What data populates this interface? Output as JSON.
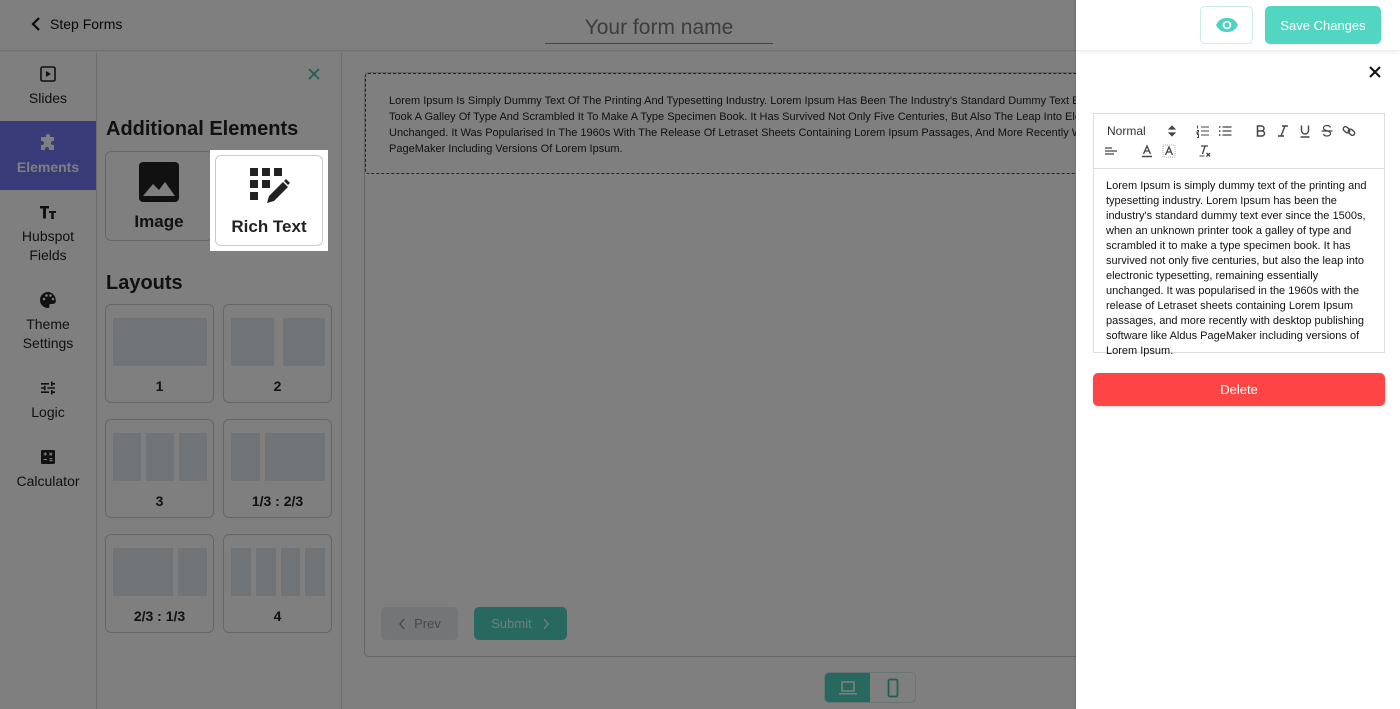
{
  "header": {
    "back_label": "Step Forms",
    "form_name_placeholder": "Your form name",
    "form_name_value": ""
  },
  "nav": {
    "items": [
      {
        "label": "Slides",
        "icon": "slides-icon"
      },
      {
        "label": "Elements",
        "icon": "puzzle-icon",
        "active": true
      },
      {
        "label": "Hubspot Fields",
        "icon": "text-size-icon"
      },
      {
        "label": "Theme Settings",
        "icon": "palette-icon"
      },
      {
        "label": "Logic",
        "icon": "sliders-icon"
      },
      {
        "label": "Calculator",
        "icon": "calculator-icon"
      }
    ]
  },
  "panel": {
    "additional_title": "Additional Elements",
    "elements": [
      {
        "label": "Image",
        "icon": "image-icon"
      },
      {
        "label": "Rich Text",
        "icon": "rich-text-icon",
        "highlighted": true
      }
    ],
    "layouts_title": "Layouts",
    "layouts": [
      {
        "label": "1"
      },
      {
        "label": "2"
      },
      {
        "label": "3"
      },
      {
        "label": "1/3 : 2/3"
      },
      {
        "label": "2/3 : 1/3"
      },
      {
        "label": "4"
      }
    ]
  },
  "canvas": {
    "rich_text_lines": [
      "Lorem Ipsum Is Simply Dummy Text Of The Printing And Typesetting Industry. Lorem Ipsum Has Been The Industry's Standard Dummy Text Ever Since The 1500s, When An Unknown Printer",
      "Took A Galley Of Type And Scrambled It To Make A Type Specimen Book. It Has Survived Not Only Five Centuries, But Also The Leap Into Electronic Typesetting, Remaining Essentially",
      "Unchanged. It Was Popularised In The 1960s With The Release Of Letraset Sheets Containing Lorem Ipsum Passages, And More Recently With Desktop Publishing Software Like Aldus",
      "PageMaker Including Versions Of Lorem Ipsum."
    ],
    "prev_label": "Prev",
    "submit_label": "Submit",
    "device_modes": [
      {
        "name": "desktop",
        "icon": "laptop-icon",
        "active": true
      },
      {
        "name": "mobile",
        "icon": "mobile-icon",
        "active": false
      }
    ]
  },
  "drawer": {
    "save_label": "Save Changes",
    "editor": {
      "header_select_value": "Normal",
      "toolbar": [
        "ordered-list",
        "bullet-list",
        "bold",
        "italic",
        "underline",
        "strike",
        "link",
        "align",
        "text-color",
        "background-color",
        "clear-format"
      ],
      "content": "Lorem Ipsum is simply dummy text of the printing and typesetting industry. Lorem Ipsum has been the industry's standard dummy text ever since the 1500s, when an unknown printer took a galley of type and scrambled it to make a type specimen book. It has survived not only five centuries, but also the leap into electronic typesetting, remaining essentially unchanged. It was popularised in the 1960s with the release of Letraset sheets containing Lorem Ipsum passages, and more recently with desktop publishing software like Aldus PageMaker including versions of Lorem Ipsum."
    },
    "delete_label": "Delete"
  },
  "colors": {
    "accent": "#52d6c2",
    "nav_active": "#7376f0",
    "danger": "#fd4545"
  }
}
